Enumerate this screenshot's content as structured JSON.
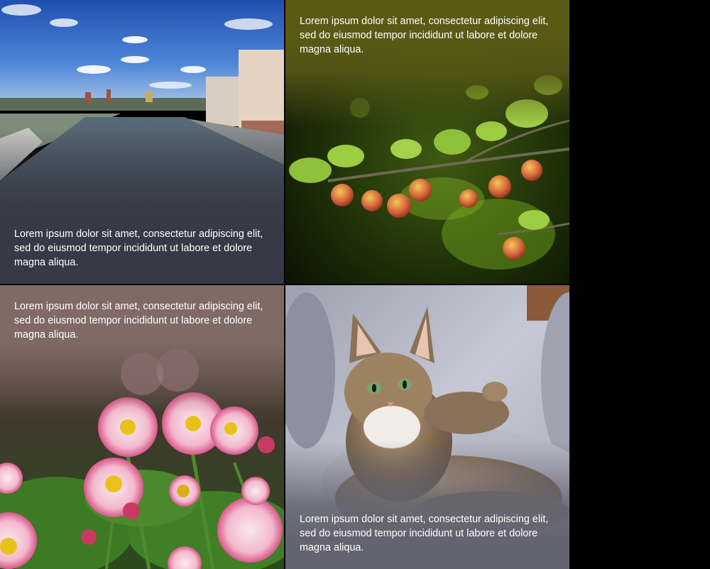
{
  "tiles": [
    {
      "caption": "Lorem ipsum dolor sit amet, consectetur adipiscing elit, sed do eiusmod tempor incididunt ut labore et dolore magna aliqua."
    },
    {
      "caption": "Lorem ipsum dolor sit amet, consectetur adipiscing elit, sed do eiusmod tempor incididunt ut labore et dolore magna aliqua."
    },
    {
      "caption": "Lorem ipsum dolor sit amet, consectetur adipiscing elit, sed do eiusmod tempor incididunt ut labore et dolore magna aliqua."
    },
    {
      "caption": "Lorem ipsum dolor sit amet, consectetur adipiscing elit, sed do eiusmod tempor incididunt ut labore et dolore magna aliqua."
    }
  ],
  "colors": {
    "page_background": "#000000",
    "city_overlay": "#363a46",
    "berry_overlay": "#5a5a14",
    "flower_overlay": "#806a66",
    "cat_overlay": "#646470",
    "caption_text": "#ffffff"
  }
}
